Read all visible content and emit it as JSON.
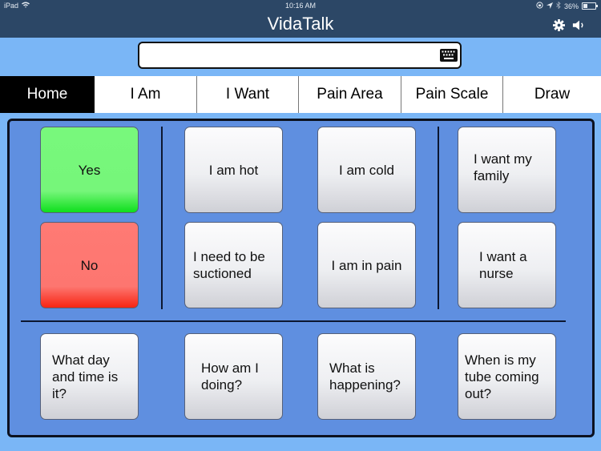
{
  "status_bar": {
    "device": "iPad",
    "time": "10:16 AM",
    "battery": "36%"
  },
  "header": {
    "title": "VidaTalk",
    "icons": [
      "gear-icon",
      "speaker-icon"
    ]
  },
  "message_input": {
    "value": "",
    "icon": "keyboard-icon"
  },
  "tabs": [
    {
      "label": "Home",
      "active": true
    },
    {
      "label": "I Am",
      "active": false
    },
    {
      "label": "I Want",
      "active": false
    },
    {
      "label": "Pain Area",
      "active": false
    },
    {
      "label": "Pain Scale",
      "active": false
    },
    {
      "label": "Draw",
      "active": false
    }
  ],
  "board": {
    "response_tiles": [
      {
        "label": "Yes",
        "color": "#76f67a"
      },
      {
        "label": "No",
        "color": "#fd7670"
      }
    ],
    "i_am_tiles": [
      {
        "label": "I am hot"
      },
      {
        "label": "I am cold"
      },
      {
        "label": "I need to be suctioned"
      },
      {
        "label": "I am in pain"
      }
    ],
    "i_want_tiles": [
      {
        "label": "I want my family"
      },
      {
        "label": "I want a nurse"
      }
    ],
    "question_tiles": [
      {
        "label": "What day and time is it?"
      },
      {
        "label": "How am I doing?"
      },
      {
        "label": "What is happening?"
      },
      {
        "label": "When is my tube coming out?"
      }
    ]
  }
}
